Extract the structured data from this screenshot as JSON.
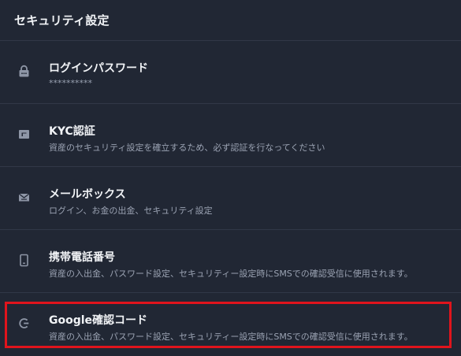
{
  "header": {
    "title": "セキュリティ設定"
  },
  "items": [
    {
      "icon": "lock-icon",
      "title": "ログインパスワード",
      "desc": "**********"
    },
    {
      "icon": "id-card-icon",
      "title": "KYC認証",
      "desc": "資産のセキュリティ設定を確立するため、必ず認証を行なってください"
    },
    {
      "icon": "mailbox-icon",
      "title": "メールボックス",
      "desc": "ログイン、お金の出金、セキュリティ設定"
    },
    {
      "icon": "phone-icon",
      "title": "携帯電話番号",
      "desc": "資産の入出金、パスワード設定、セキュリティー設定時にSMSでの確認受信に使用されます。"
    },
    {
      "icon": "google-authenticator-icon",
      "title": "Google確認コード",
      "desc": "資産の入出金、パスワード設定、セキュリティー設定時にSMSでの確認受信に使用されます。"
    }
  ],
  "colors": {
    "background": "#212734",
    "divider": "#313847",
    "highlight": "#e0141c",
    "icon": "#8e96a6"
  }
}
